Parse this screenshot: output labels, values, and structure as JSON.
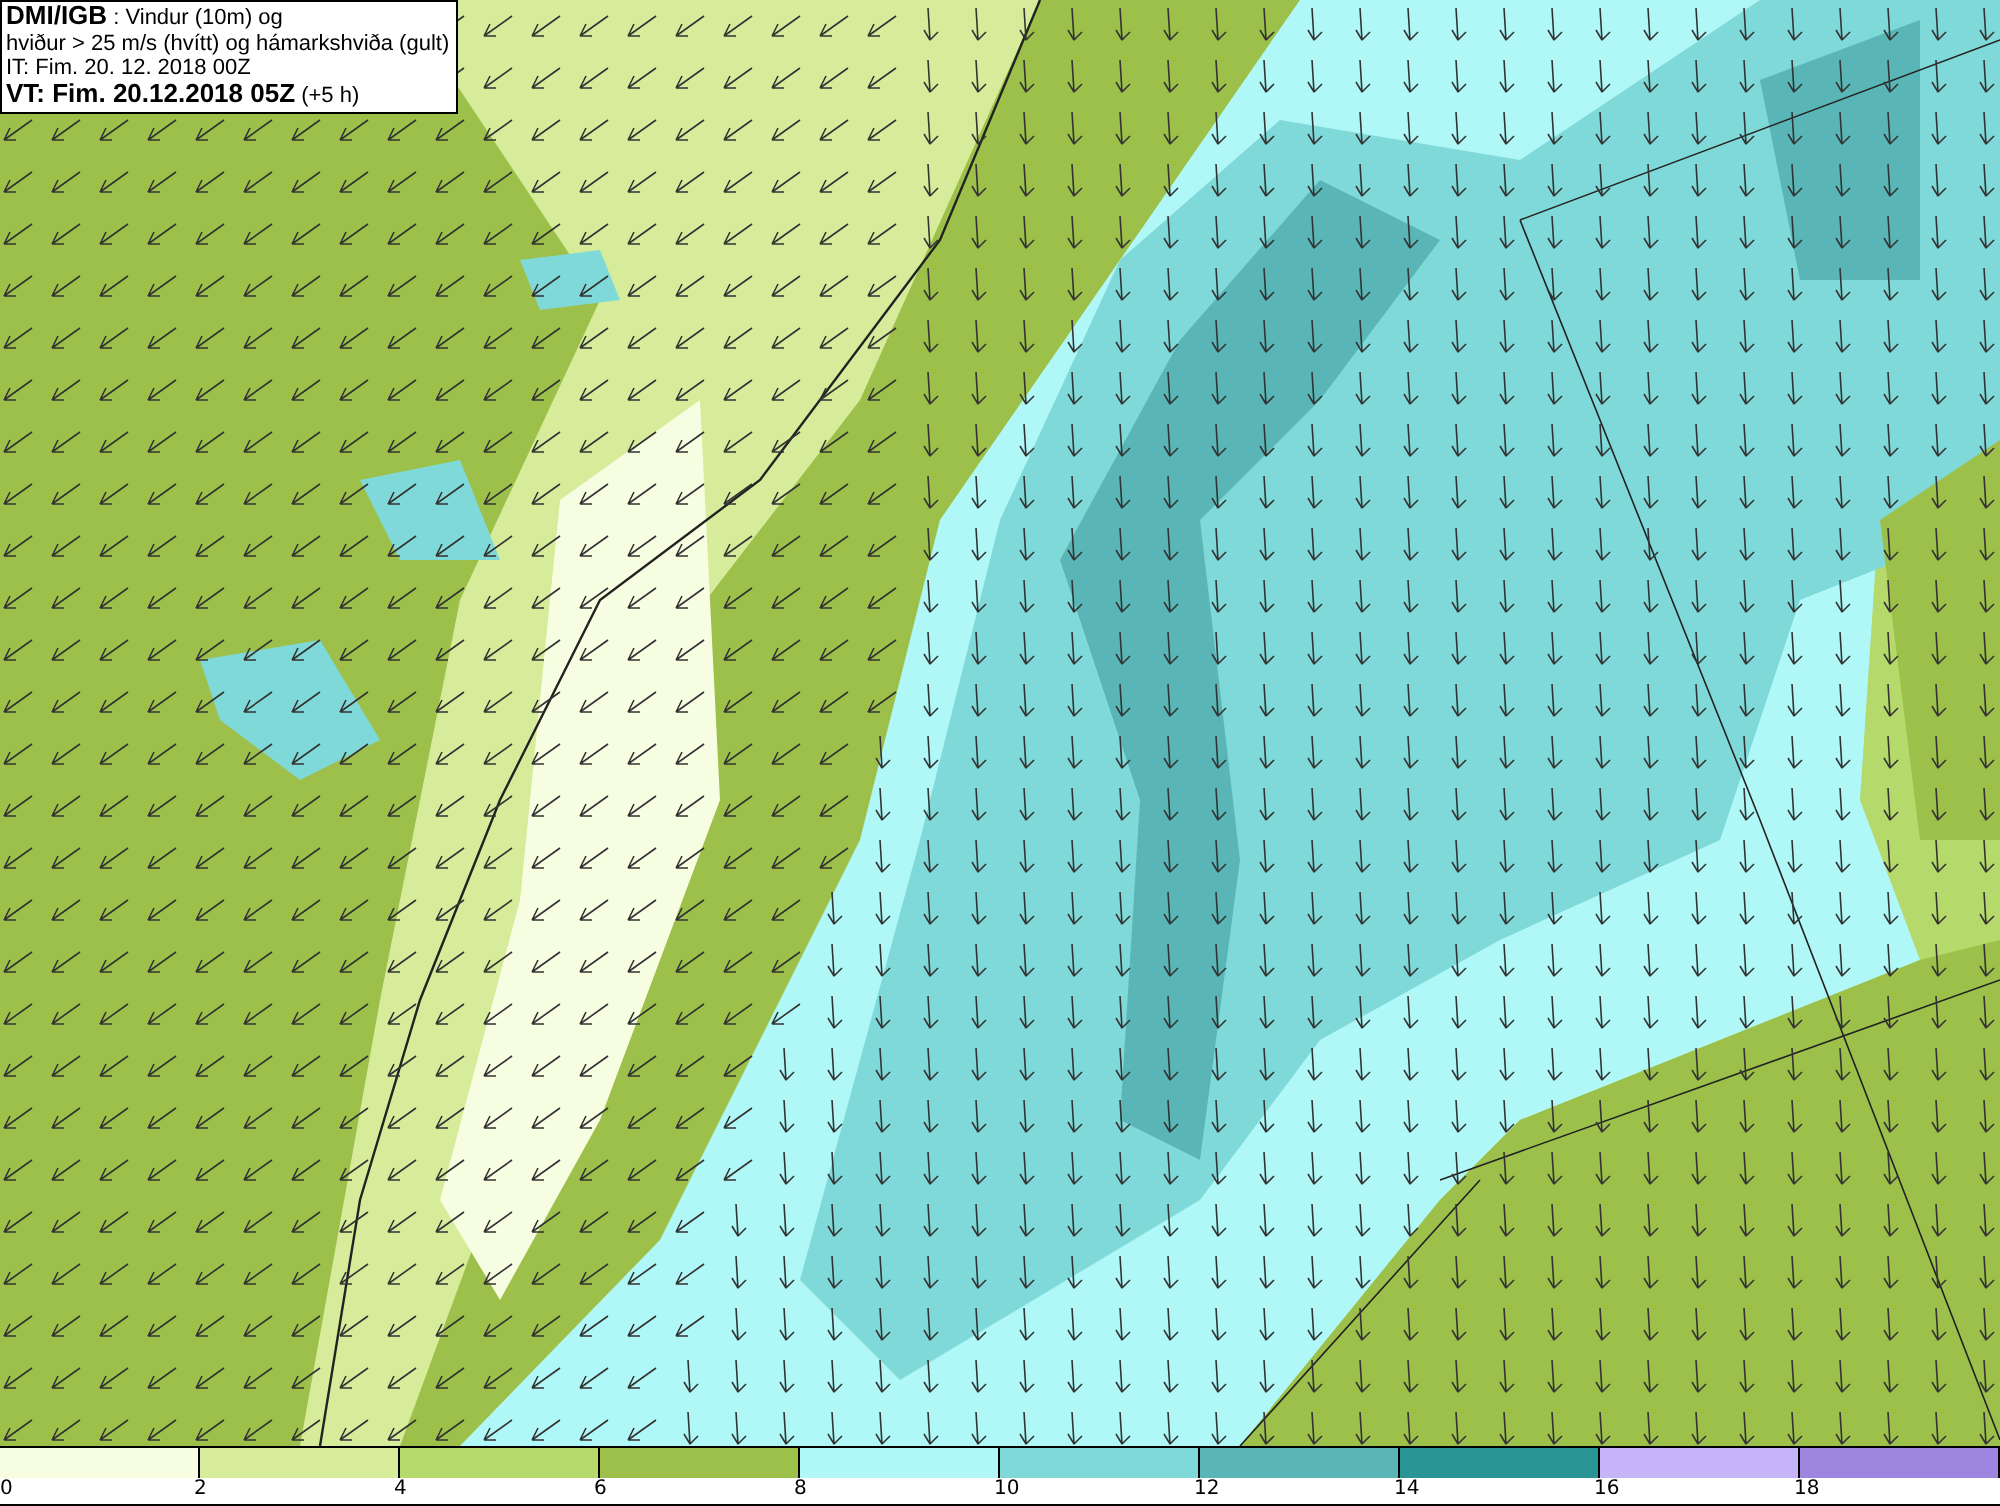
{
  "title_box": {
    "lines": [
      "**DMI/IGB** : Vindur (10m) og",
      "hviður > 25 m/s (hvítt) og hámarkshviða (gult)",
      "IT: Fim. 20. 12. 2018 00Z",
      "**VT: Fim. 20.12.2018 05Z** (+5 h)"
    ]
  },
  "legend": [
    {
      "label": "0",
      "color": "#f7fde0"
    },
    {
      "label": "2",
      "color": "#d6ec9a"
    },
    {
      "label": "4",
      "color": "#b5d96b"
    },
    {
      "label": "6",
      "color": "#9cc04a"
    },
    {
      "label": "8",
      "color": "#b0f7f7"
    },
    {
      "label": "10",
      "color": "#80d9d9"
    },
    {
      "label": "12",
      "color": "#5ab6b6"
    },
    {
      "label": "14",
      "color": "#2a9595"
    },
    {
      "label": "16",
      "color": "#c6b4f8"
    },
    {
      "label": "18",
      "color": "#9e86e0"
    }
  ]
}
